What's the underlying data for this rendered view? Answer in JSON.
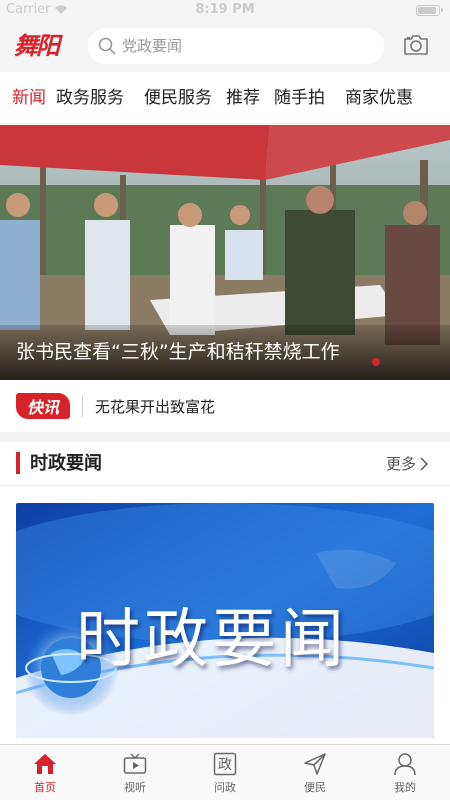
{
  "status_bar": {
    "carrier": "Carrier",
    "time": "8:19 PM"
  },
  "header": {
    "logo": "舞阳",
    "search": {
      "placeholder": "党政要闻"
    }
  },
  "tabs": [
    {
      "label": "新闻",
      "active": true
    },
    {
      "label": "政务服务",
      "active": false
    },
    {
      "label": "便民服务",
      "active": false
    },
    {
      "label": "推荐",
      "active": false
    },
    {
      "label": "随手拍",
      "active": false
    },
    {
      "label": "商家优惠",
      "active": false
    }
  ],
  "banner": {
    "caption": "张书民查看“三秋”生产和秸秆禁烧工作"
  },
  "flash": {
    "badge": "快讯",
    "text": "无花果开出致富花"
  },
  "section": {
    "title": "时政要闻",
    "more": "更多",
    "image_title": "时政要闻"
  },
  "bottom_nav": [
    {
      "label": "首页",
      "icon": "home-icon",
      "active": true
    },
    {
      "label": "视听",
      "icon": "tv-icon",
      "active": false
    },
    {
      "label": "问政",
      "icon": "zheng-icon",
      "active": false
    },
    {
      "label": "便民",
      "icon": "send-icon",
      "active": false
    },
    {
      "label": "我的",
      "icon": "user-icon",
      "active": false
    }
  ],
  "colors": {
    "accent": "#d6232a",
    "banner_blue": "#1565c8"
  }
}
